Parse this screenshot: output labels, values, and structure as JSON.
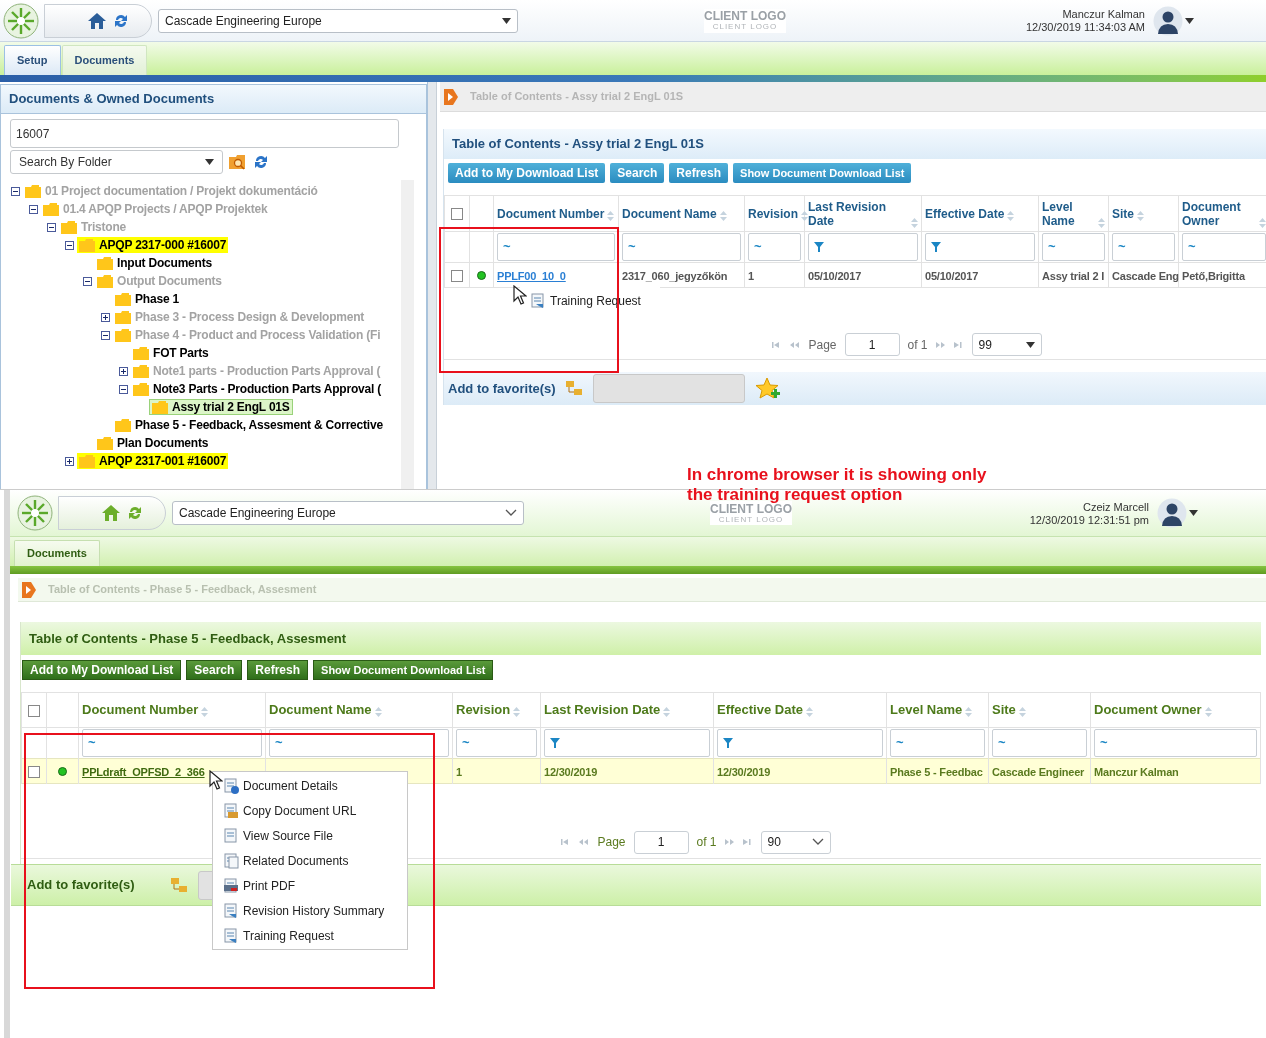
{
  "top_screen": {
    "header": {
      "company": "Cascade Engineering Europe",
      "client_logo": "CLIENT LOGO",
      "client_logo_sub": "CLIENT LOGO",
      "user_name": "Manczur Kalman",
      "datetime": "12/30/2019 11:34:03 AM"
    },
    "tabs": [
      {
        "label": "Setup",
        "selected": true
      },
      {
        "label": "Documents",
        "selected": false
      }
    ],
    "tree_panel": {
      "title": "Documents & Owned Documents",
      "search_value": "16007",
      "search_by": "Search By Folder",
      "tree": [
        {
          "label": "01 Project documentation / Projekt dokumentáció",
          "expanded": true,
          "dimmed": true,
          "highlighted": false,
          "selected": false,
          "children": [
            {
              "label": "01.4 APQP Projects / APQP Projektek",
              "expanded": true,
              "dimmed": true,
              "highlighted": false,
              "selected": false,
              "children": [
                {
                  "label": "Tristone",
                  "expanded": true,
                  "dimmed": true,
                  "highlighted": false,
                  "selected": false,
                  "children": [
                    {
                      "label": "APQP 2317-000 #16007",
                      "expanded": true,
                      "dimmed": false,
                      "highlighted": true,
                      "selected": false,
                      "children": [
                        {
                          "label": "Input Documents",
                          "dimmed": false,
                          "highlighted": false,
                          "selected": false
                        },
                        {
                          "label": "Output Documents",
                          "expanded": true,
                          "dimmed": true,
                          "highlighted": false,
                          "selected": false,
                          "children": [
                            {
                              "label": "Phase 1",
                              "dimmed": false,
                              "highlighted": false,
                              "selected": false
                            },
                            {
                              "label": "Phase 3 - Process Design & Development",
                              "expanded": false,
                              "dimmed": true,
                              "highlighted": false,
                              "selected": false
                            },
                            {
                              "label": "Phase 4 - Product and Process Validation (Fi",
                              "expanded": true,
                              "dimmed": true,
                              "highlighted": false,
                              "selected": false,
                              "children": [
                                {
                                  "label": "FOT Parts",
                                  "dimmed": false,
                                  "highlighted": false,
                                  "selected": false
                                },
                                {
                                  "label": "Note1 parts - Production Parts Approval (",
                                  "expanded": false,
                                  "dimmed": true,
                                  "highlighted": false,
                                  "selected": false
                                },
                                {
                                  "label": "Note3 Parts - Production Parts Approval (",
                                  "expanded": true,
                                  "dimmed": false,
                                  "highlighted": false,
                                  "selected": false,
                                  "children": [
                                    {
                                      "label": "Assy trial 2 EngL 01S",
                                      "dimmed": false,
                                      "highlighted": false,
                                      "selected": true
                                    }
                                  ]
                                }
                              ]
                            },
                            {
                              "label": "Phase 5 - Feedback, Assesment & Corrective",
                              "dimmed": false,
                              "highlighted": false,
                              "selected": false
                            }
                          ]
                        },
                        {
                          "label": "Plan Documents",
                          "dimmed": false,
                          "highlighted": false,
                          "selected": false
                        }
                      ]
                    },
                    {
                      "label": "APQP 2317-001 #16007",
                      "expanded": false,
                      "dimmed": false,
                      "highlighted": true,
                      "selected": false
                    }
                  ]
                }
              ]
            }
          ]
        }
      ]
    },
    "breadcrumb": "Table of Contents - Assy trial 2 EngL 01S",
    "select_all_checked": false,
    "panel_title": "Table of Contents - Assy trial 2 EngL 01S",
    "buttons": [
      "Add to My Download List",
      "Search",
      "Refresh",
      "Show Document Download List"
    ],
    "columns": [
      {
        "label": "Document Number",
        "kind": "text",
        "filter": "~"
      },
      {
        "label": "Document Name",
        "kind": "text",
        "filter": "~"
      },
      {
        "label": "Revision",
        "kind": "text",
        "filter": "~"
      },
      {
        "label": "Last Revision Date",
        "kind": "date"
      },
      {
        "label": "Effective Date",
        "kind": "date"
      },
      {
        "label": "Level Name",
        "kind": "text",
        "filter": "~"
      },
      {
        "label": "Site",
        "kind": "text",
        "filter": "~"
      },
      {
        "label": "Document Owner",
        "kind": "text",
        "filter": "~"
      }
    ],
    "rows": [
      {
        "checked": false,
        "color": "#22c322",
        "cells": [
          "PPLF00_10_0",
          "2317_060_jegyzőkön",
          "1",
          "05/10/2017",
          "05/10/2017",
          "Assy trial 2 I",
          "Cascade Eng",
          "Pető,Brigitta"
        ]
      }
    ],
    "context_menu": [
      {
        "label": "Training Request"
      }
    ],
    "pager": {
      "page_label": "Page",
      "page": "1",
      "of": "of 1",
      "page_size": "99"
    },
    "favorites_label": "Add to favorite(s)"
  },
  "annotation": "In chrome browser it is showing only the training request option",
  "bottom_screen": {
    "header": {
      "company": "Cascade Engineering Europe",
      "client_logo": "CLIENT LOGO",
      "client_logo_sub": "CLIENT LOGO",
      "user_name": "Czeiz Marcell",
      "datetime": "12/30/2019 12:31:51 pm"
    },
    "tabs": [
      {
        "label": "Documents",
        "selected": true
      }
    ],
    "breadcrumb": "Table of Contents - Phase 5 - Feedback, Assesment",
    "select_all_checked": false,
    "panel_title": "Table of Contents - Phase 5 - Feedback, Assesment",
    "buttons": [
      "Add to My Download List",
      "Search",
      "Refresh",
      "Show Document Download List"
    ],
    "columns": [
      {
        "label": "Document Number",
        "kind": "text",
        "filter": "~"
      },
      {
        "label": "Document Name",
        "kind": "text",
        "filter": "~"
      },
      {
        "label": "Revision",
        "kind": "text",
        "filter": "~"
      },
      {
        "label": "Last Revision Date",
        "kind": "date"
      },
      {
        "label": "Effective Date",
        "kind": "date"
      },
      {
        "label": "Level Name",
        "kind": "text",
        "filter": "~"
      },
      {
        "label": "Site",
        "kind": "text",
        "filter": "~"
      },
      {
        "label": "Document Owner",
        "kind": "text",
        "filter": "~"
      }
    ],
    "rows": [
      {
        "checked": false,
        "color": "#22c322",
        "cells": [
          "PPLdraft_OPFSD_2_366",
          null,
          "1",
          "12/30/2019",
          "12/30/2019",
          "Phase 5 - Feedbac",
          "Cascade Engineer",
          "Manczur Kalman"
        ]
      }
    ],
    "context_menu": [
      {
        "label": "Document Details"
      },
      {
        "label": "Copy Document URL"
      },
      {
        "label": "View Source File"
      },
      {
        "label": "Related Documents"
      },
      {
        "label": "Print PDF"
      },
      {
        "label": "Revision History Summary"
      },
      {
        "label": "Training Request"
      }
    ],
    "pager": {
      "page_label": "Page",
      "page": "1",
      "of": "of 1",
      "page_size": "90"
    },
    "favorites_label": "Add to favorite(s)"
  }
}
